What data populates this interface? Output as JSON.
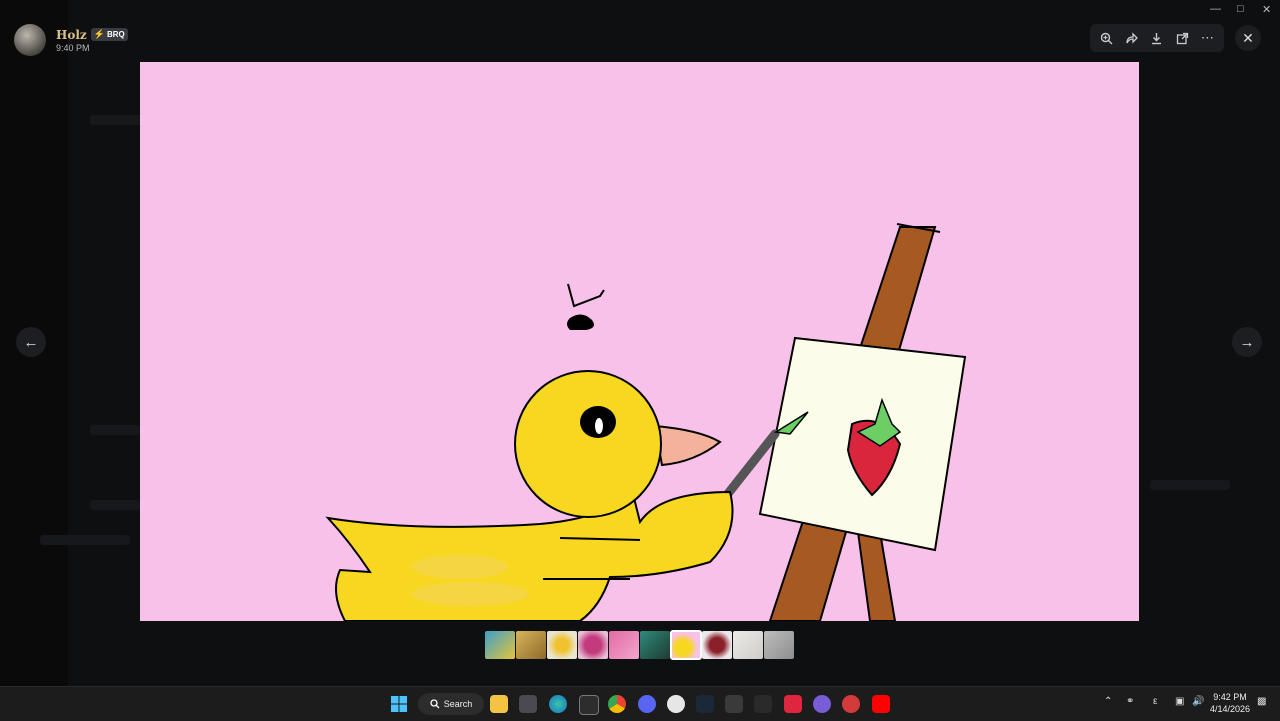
{
  "viewer": {
    "uploader_name": "Holz",
    "uploader_tag": "BRQ",
    "timestamp": "9:40 PM"
  },
  "image_alt": "Drawing of a yellow duck painting a strawberry on an easel",
  "colors": {
    "image_background": "#f8c1ea",
    "duck_yellow": "#f7d71f",
    "beak": "#f4b29a",
    "easel_brown": "#a65a22",
    "canvas_white": "#fbfdea",
    "strawberry_red": "#d9263d",
    "leaf_green": "#6ccf66"
  },
  "toolbar": {
    "icons": [
      "zoom-in-icon",
      "forward-icon",
      "download-icon",
      "open-external-icon",
      "more-icon"
    ]
  },
  "taskbar": {
    "search_label": "Search",
    "time": "9:42 PM",
    "date": "4/14/2026"
  }
}
